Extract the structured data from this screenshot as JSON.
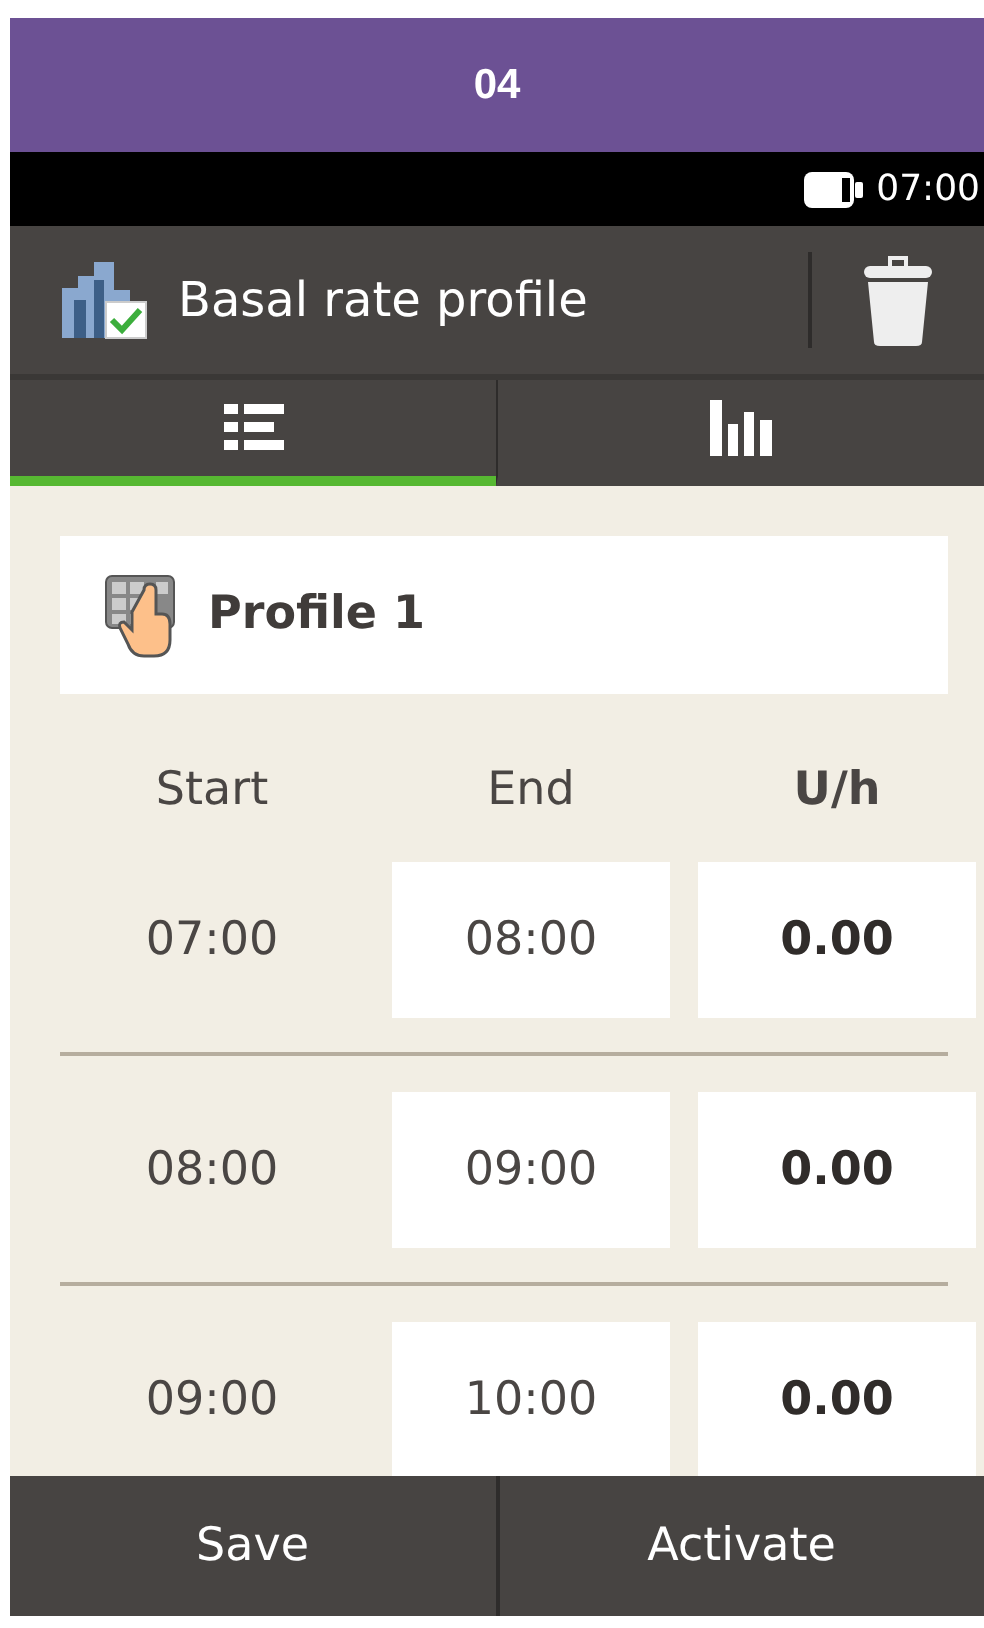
{
  "title_bar": {
    "text": "04"
  },
  "status_bar": {
    "time": "07:00"
  },
  "header": {
    "title": "Basal rate profile"
  },
  "tabs": [
    {
      "kind": "list",
      "selected": true
    },
    {
      "kind": "chart",
      "selected": false
    }
  ],
  "profile": {
    "name": "Profile 1"
  },
  "table": {
    "columns": [
      "Start",
      "End",
      "U/h"
    ],
    "rows": [
      {
        "start": "07:00",
        "end": "08:00",
        "rate": "0.00"
      },
      {
        "start": "08:00",
        "end": "09:00",
        "rate": "0.00"
      },
      {
        "start": "09:00",
        "end": "10:00",
        "rate": "0.00"
      }
    ]
  },
  "buttons": [
    "Save",
    "Activate"
  ]
}
